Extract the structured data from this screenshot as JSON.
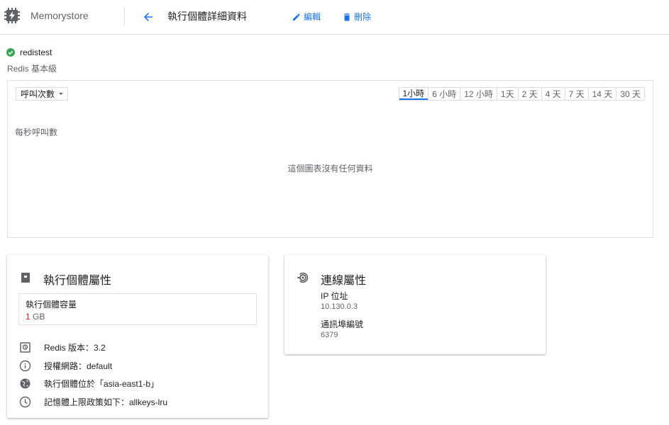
{
  "header": {
    "product_name": "Memorystore",
    "page_title": "執行個體詳細資料",
    "edit_label": "編輯",
    "delete_label": "刪除",
    "product_icon": "memorystore-chip-icon",
    "back_icon": "arrow-back-icon"
  },
  "instance": {
    "name": "redistest",
    "tier": "Redis 基本級",
    "status_icon": "check-circle-icon",
    "status_color": "#34a853"
  },
  "chart": {
    "metric": "呼叫次數",
    "time_ranges": [
      "1小時",
      "6 小時",
      "12 小時",
      "1天",
      "2 天",
      "4 天",
      "7 天",
      "14 天",
      "30 天"
    ],
    "active_range": "1小時",
    "ylabel": "每秒呼叫數",
    "empty_message": "這個圖表沒有任何資料"
  },
  "instance_props": {
    "title": "執行個體屬性",
    "capacity_label": "執行個體容量",
    "capacity_value": "1",
    "capacity_unit": " GB",
    "items": [
      {
        "icon": "version-icon",
        "text": "Redis 版本：3.2"
      },
      {
        "icon": "info-icon",
        "text": "授權網路：default"
      },
      {
        "icon": "globe-icon",
        "text": "執行個體位於「asia-east1-b」"
      },
      {
        "icon": "clock-icon",
        "text": "記憶體上限政策如下：allkeys-lru"
      }
    ]
  },
  "connection_props": {
    "title": "連線屬性",
    "ip_label": "IP 位址",
    "ip_value": "10.130.0.3",
    "port_label": "通訊埠編號",
    "port_value": "6379"
  },
  "colors": {
    "accent": "#1a73e8",
    "text": "#202124",
    "secondary": "#5f6368",
    "capacity_number": "#c5221f"
  }
}
